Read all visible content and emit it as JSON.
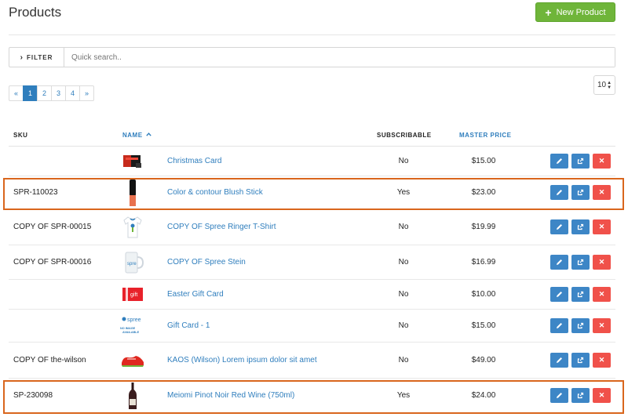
{
  "header": {
    "title": "Products",
    "new_button_label": "New Product"
  },
  "filter": {
    "toggle_label": "FILTER",
    "search_placeholder": "Quick search.."
  },
  "pagination": {
    "prev": "«",
    "pages": [
      "1",
      "2",
      "3",
      "4"
    ],
    "next": "»",
    "current": "1"
  },
  "per_page": {
    "value": "10"
  },
  "columns": {
    "sku": "SKU",
    "name": "NAME",
    "subscribable": "SUBSCRIBABLE",
    "master_price": "MASTER PRICE"
  },
  "rows": [
    {
      "sku": "",
      "name": "Christmas Card",
      "subscribable": "No",
      "price": "$15.00",
      "image": "red-card-thumbnail",
      "highlighted": false
    },
    {
      "sku": "SPR-110023",
      "name": "Color & contour Blush Stick",
      "subscribable": "Yes",
      "price": "$23.00",
      "image": "blush-stick-thumbnail",
      "highlighted": true
    },
    {
      "sku": "COPY OF SPR-00015",
      "name": "COPY OF Spree Ringer T-Shirt",
      "subscribable": "No",
      "price": "$19.99",
      "image": "t-shirt-thumbnail",
      "highlighted": false
    },
    {
      "sku": "COPY OF SPR-00016",
      "name": "COPY OF Spree Stein",
      "subscribable": "No",
      "price": "$16.99",
      "image": "stein-mug-thumbnail",
      "highlighted": false
    },
    {
      "sku": "",
      "name": "Easter Gift Card",
      "subscribable": "No",
      "price": "$10.00",
      "image": "gift-card-thumbnail",
      "highlighted": false
    },
    {
      "sku": "",
      "name": "Gift Card - 1",
      "subscribable": "No",
      "price": "$15.00",
      "image": "no-image-placeholder",
      "highlighted": false
    },
    {
      "sku": "COPY OF the-wilson",
      "name": "KAOS (Wilson) Lorem ipsum dolor sit amet",
      "subscribable": "No",
      "price": "$49.00",
      "image": "red-shoe-thumbnail",
      "highlighted": false
    },
    {
      "sku": "SP-230098",
      "name": "Meiomi Pinot Noir Red Wine (750ml)",
      "subscribable": "Yes",
      "price": "$24.00",
      "image": "wine-bottle-thumbnail",
      "highlighted": true
    }
  ],
  "thumbnails": {
    "gift_label": "gift",
    "spree_label": "spree",
    "no_image_label": "NO IMAGE AVAILABLE"
  },
  "icons": {
    "edit": "pencil-icon",
    "clone": "clone-icon",
    "delete": "close-icon"
  },
  "colors": {
    "primary": "#2f7ebd",
    "success": "#6fb53a",
    "danger": "#f0514a",
    "highlight": "#d9661d"
  }
}
